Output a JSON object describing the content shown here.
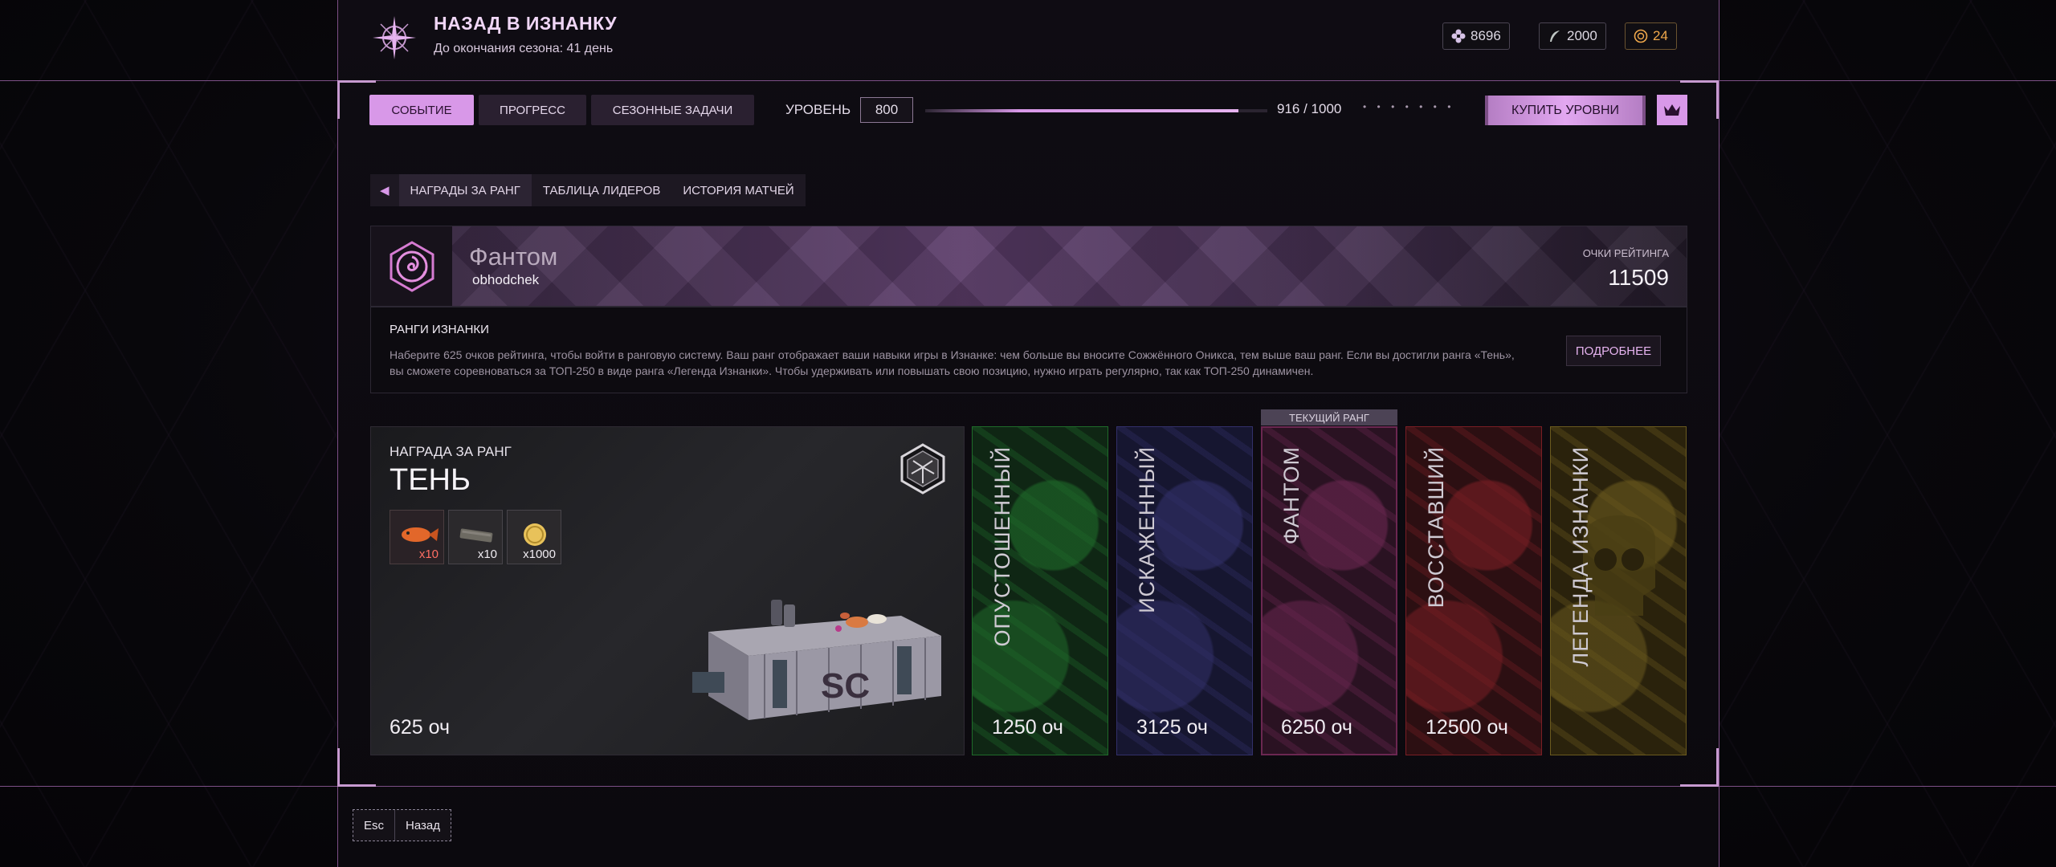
{
  "header": {
    "title": "НАЗАД В ИЗНАНКУ",
    "subtitle": "До окончания сезона: 41 день",
    "currencies": [
      {
        "icon": "flower-currency-icon",
        "value": "8696",
        "color": "#d6c2e6"
      },
      {
        "icon": "feather-currency-icon",
        "value": "2000",
        "color": "#bfc6c4"
      },
      {
        "icon": "coin-currency-icon",
        "value": "24",
        "color": "#f0a84b"
      }
    ]
  },
  "tabs": [
    {
      "label": "СОБЫТИЕ",
      "active": true
    },
    {
      "label": "ПРОГРЕСС",
      "active": false
    },
    {
      "label": "СЕЗОННЫЕ ЗАДАЧИ",
      "active": false
    }
  ],
  "level": {
    "label": "УРОВЕНЬ",
    "value": "800",
    "progress_text": "916 / 1000",
    "progress_fraction": 0.916,
    "dots": "• • • • • • •"
  },
  "buy_button": "КУПИТЬ УРОВНИ",
  "subtabs": [
    {
      "label": "НАГРАДЫ ЗА РАНГ",
      "active": true
    },
    {
      "label": "ТАБЛИЦА ЛИДЕРОВ",
      "active": false
    },
    {
      "label": "ИСТОРИЯ МАТЧЕЙ",
      "active": false
    }
  ],
  "profile": {
    "rank": "Фантом",
    "username": "obhodchek",
    "rating_label": "ОЧКИ РЕЙТИНГА",
    "rating_value": "11509"
  },
  "info": {
    "title": "РАНГИ ИЗНАНКИ",
    "text": "Наберите 625 очков рейтинга, чтобы войти в ранговую систему. Ваш ранг отображает ваши навыки игры в Изнанке: чем больше вы вносите Сожжённого Оникса, тем выше ваш ранг. Если вы достигли ранга «Тень», вы сможете соревноваться за ТОП-250 в виде ранга «Легенда Изнанки». Чтобы удерживать или повышать свою позицию, нужно играть регулярно, так как ТОП-250 динамичен.",
    "more_button": "ПОДРОБНЕЕ"
  },
  "reward": {
    "label": "НАГРАДА ЗА РАНГ",
    "rank": "ТЕНЬ",
    "points": "625 оч",
    "items": [
      {
        "icon": "fish-item-icon",
        "qty": "x10",
        "color": "#ff6e63"
      },
      {
        "icon": "plank-item-icon",
        "qty": "x10",
        "color": "#f0ecf2"
      },
      {
        "icon": "gold-coin-item-icon",
        "qty": "x1000",
        "color": "#f0ecf2"
      }
    ]
  },
  "current_rank_tag": "ТЕКУЩИЙ РАНГ",
  "ranks": [
    {
      "name": "ОПУСТОШЕННЫЙ",
      "points": "1250 оч",
      "color": "#1f6b2a",
      "bg": "#0f2614"
    },
    {
      "name": "ИСКАЖЕННЫЙ",
      "points": "3125 оч",
      "color": "#32306a",
      "bg": "#161630"
    },
    {
      "name": "ФАНТОМ",
      "points": "6250 оч",
      "color": "#6b2751",
      "bg": "#2a1222",
      "current": true
    },
    {
      "name": "ВОССТАВШИЙ",
      "points": "12500 оч",
      "color": "#7a1e24",
      "bg": "#2c0f12"
    },
    {
      "name": "ЛЕГЕНДА ИЗНАНКИ",
      "points": "",
      "color": "#6b5a1e",
      "bg": "#2a220c"
    }
  ],
  "footer": {
    "key": "Esc",
    "label": "Назад"
  }
}
